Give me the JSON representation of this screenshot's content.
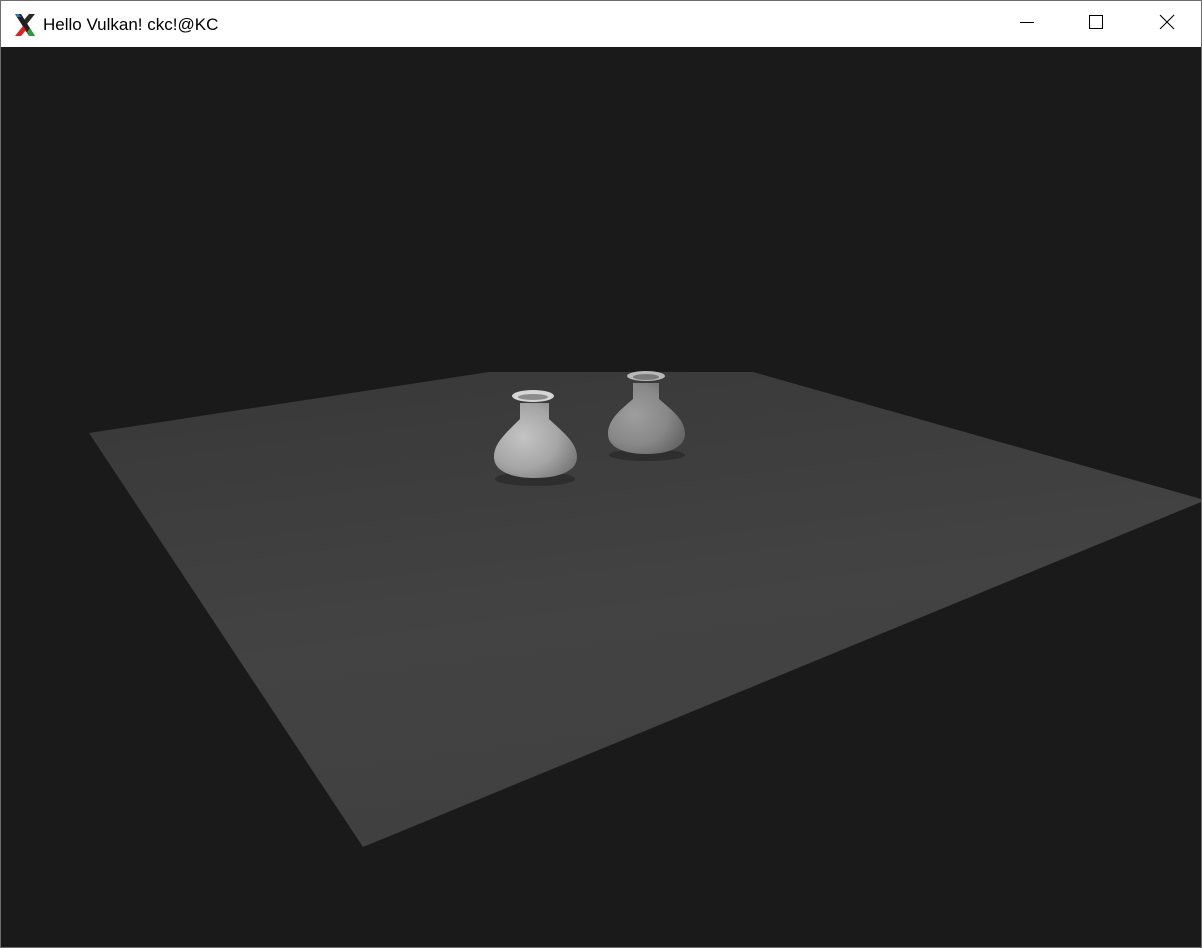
{
  "window": {
    "title": "Hello Vulkan! ckc!@KC"
  },
  "titlebar": {
    "app_icon": "x-server-logo-icon",
    "minimize_icon": "minimize-icon",
    "maximize_icon": "maximize-icon",
    "close_icon": "close-icon"
  },
  "scene": {
    "background_color": "#1a1a1a",
    "floor_color": "#404040",
    "object_color": "#a8a8a8",
    "objects": [
      "vase",
      "vase"
    ]
  }
}
